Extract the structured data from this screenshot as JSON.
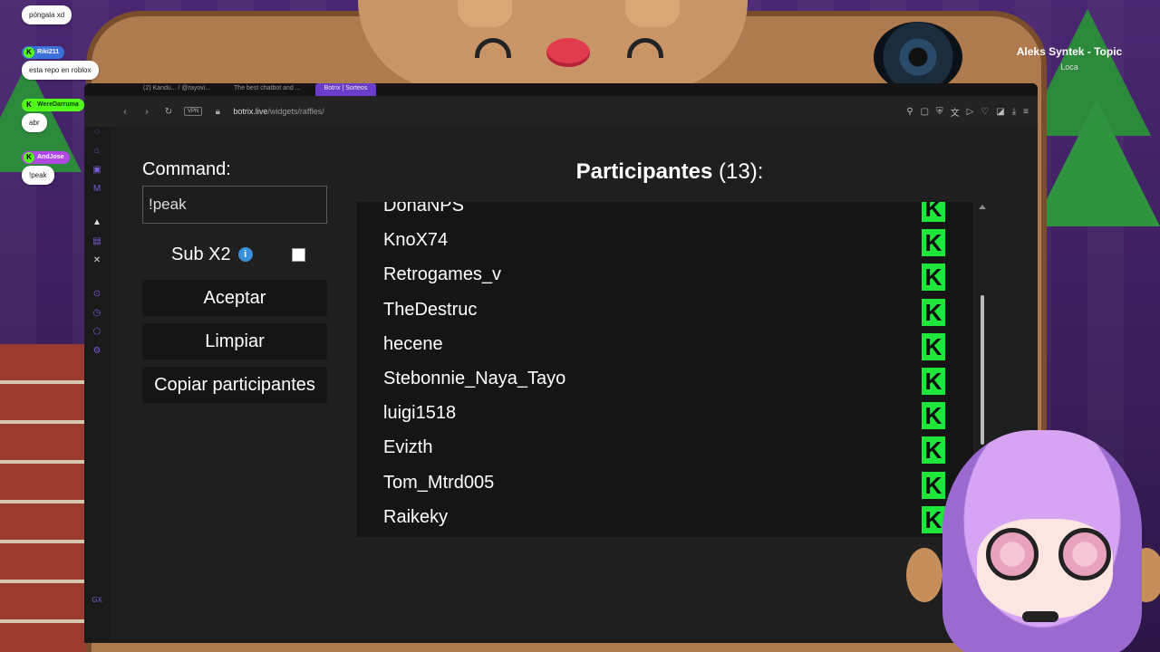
{
  "chat": [
    {
      "user": "",
      "user_color": "#ff9a2a",
      "text": "póngala xd"
    },
    {
      "user": "Riki211",
      "user_color": "#3b6fd9",
      "text": "esta repo en roblox"
    },
    {
      "user": "WereDarruma",
      "user_color": "#53fc18",
      "text": "abr"
    },
    {
      "user": "AndJose",
      "user_color": "#b047e0",
      "text": "!peak"
    }
  ],
  "now_playing": {
    "title": "Aleks Syntek - Topic",
    "artist": "Loca"
  },
  "browser": {
    "tabs": [
      "(2) Kandu... / @rayovi...",
      "The best chatbot and ...",
      "Botrix | Sorteos"
    ],
    "vpn_label": "VPN",
    "url_host": "botrix.live",
    "url_path": "/widgets/raffles/",
    "sidebar_bottom_label": "GX"
  },
  "raffle": {
    "command_label": "Command:",
    "command_value": "!peak",
    "sub_label": "Sub X2",
    "sub_checked": false,
    "accept_label": "Aceptar",
    "clear_label": "Limpiar",
    "copy_label": "Copiar participantes",
    "participants_title": "Participantes",
    "participants_count": "(13):",
    "platform_badge": "K",
    "accent_color": "#1ee63a",
    "participants": [
      "DonaNPS",
      "KnoX74",
      "Retrogames_v",
      "TheDestruc",
      "hecene",
      "Stebonnie_Naya_Tayo",
      "luigi1518",
      "Evizth",
      "Tom_Mtrd005",
      "Raikeky"
    ]
  }
}
